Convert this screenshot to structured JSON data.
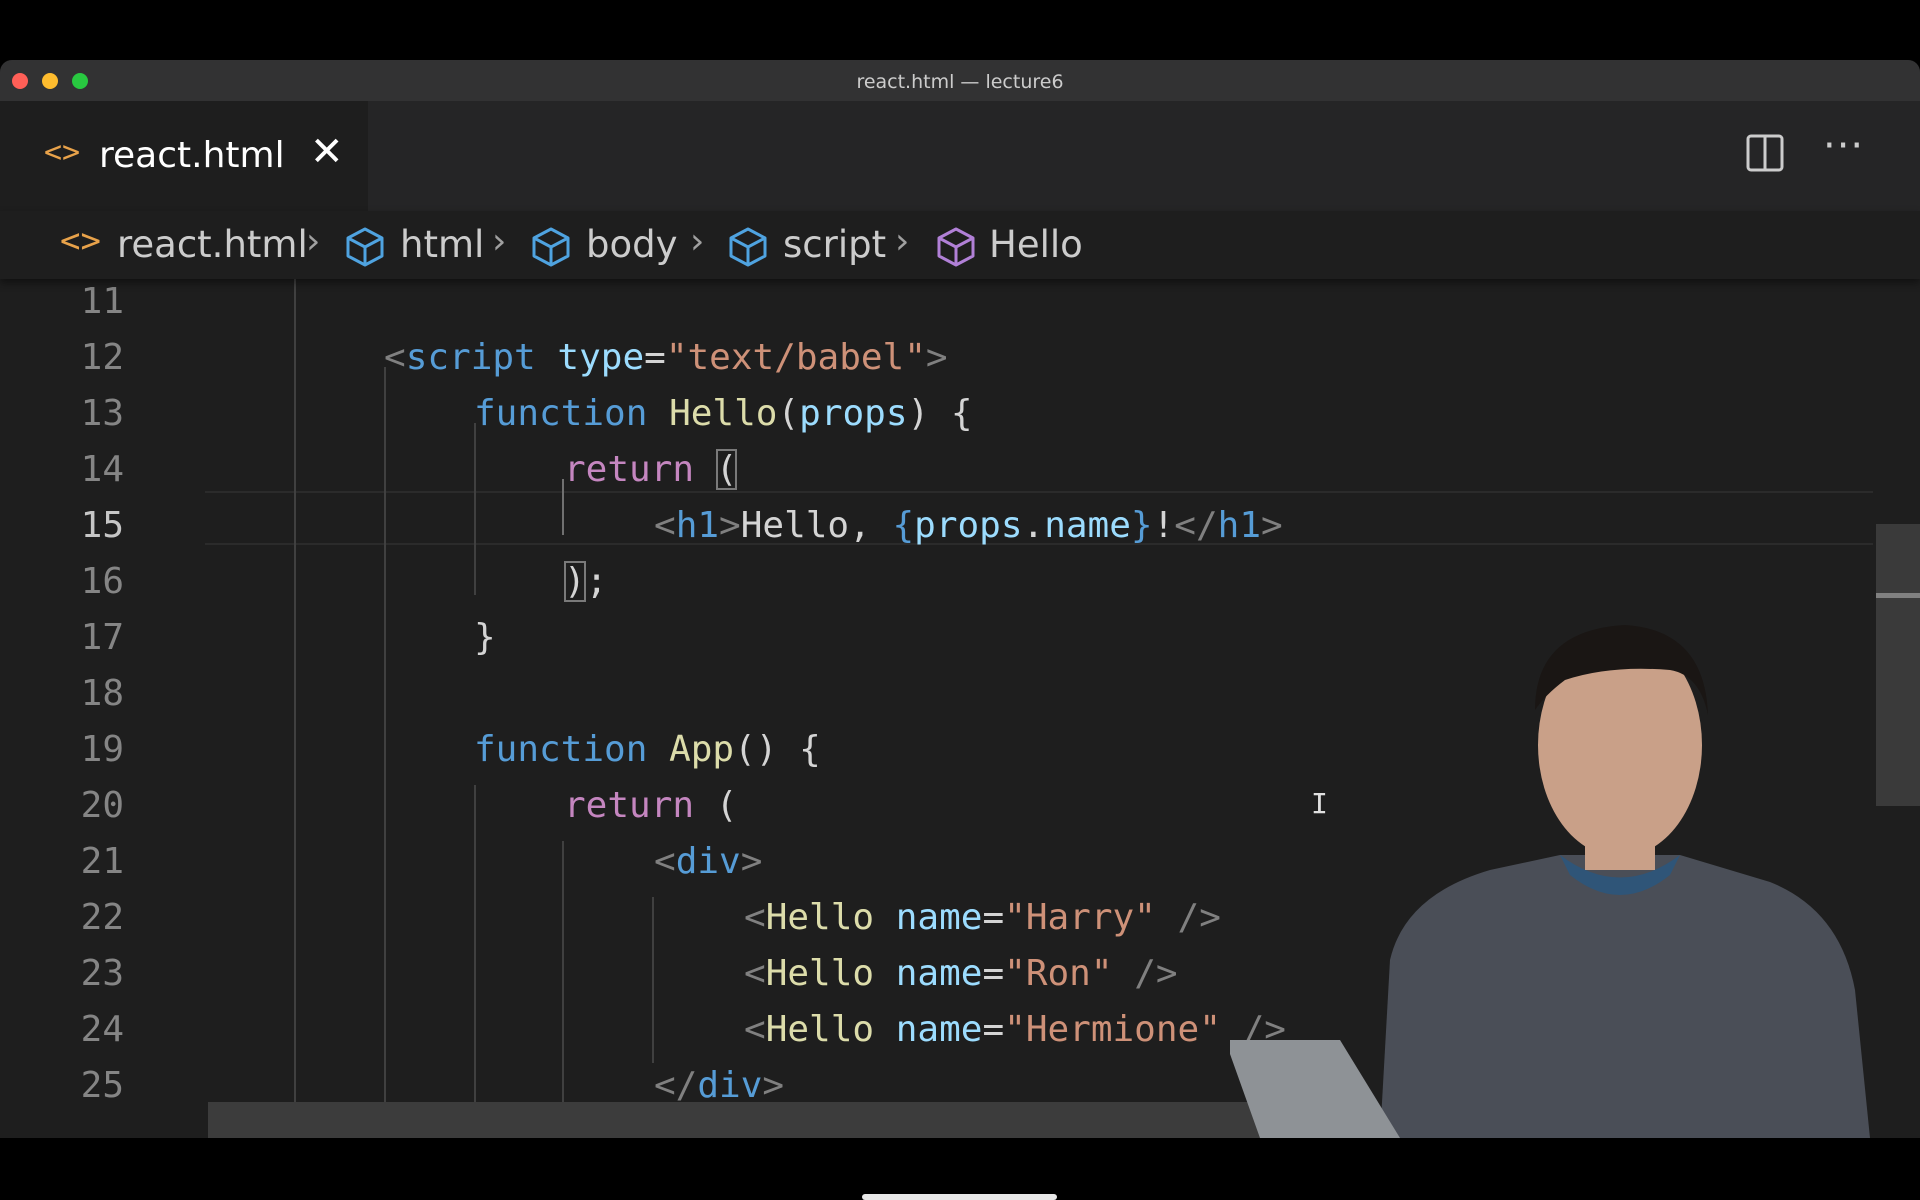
{
  "window": {
    "title": "react.html — lecture6"
  },
  "tab": {
    "icon": "code-brackets-icon",
    "label": "react.html",
    "close_glyph": "✕"
  },
  "toolbar": {
    "split_icon": "split-editor-icon",
    "more_glyph": "···"
  },
  "breadcrumb": {
    "file_icon": "code-brackets-icon",
    "items": [
      {
        "label": "react.html",
        "icon": "code-brackets-icon"
      },
      {
        "label": "html",
        "icon": "cube-icon"
      },
      {
        "label": "body",
        "icon": "cube-icon"
      },
      {
        "label": "script",
        "icon": "cube-icon"
      },
      {
        "label": "Hello",
        "icon": "cube-icon"
      }
    ],
    "separator": "›"
  },
  "editor": {
    "active_line": 15,
    "line_numbers": [
      "11",
      "12",
      "13",
      "14",
      "15",
      "16",
      "17",
      "18",
      "19",
      "20",
      "21",
      "22",
      "23",
      "24",
      "25"
    ],
    "lines": [
      {
        "num": "11",
        "tokens": []
      },
      {
        "num": "12",
        "indent": 1,
        "tokens": [
          {
            "t": "<",
            "c": "tag"
          },
          {
            "t": "script",
            "c": "el"
          },
          {
            "t": " ",
            "c": "txt"
          },
          {
            "t": "type",
            "c": "attr"
          },
          {
            "t": "=",
            "c": "txt"
          },
          {
            "t": "\"text/babel\"",
            "c": "str"
          },
          {
            "t": ">",
            "c": "tag"
          }
        ]
      },
      {
        "num": "13",
        "indent": 2,
        "tokens": [
          {
            "t": "function",
            "c": "kw"
          },
          {
            "t": " ",
            "c": "txt"
          },
          {
            "t": "Hello",
            "c": "fn"
          },
          {
            "t": "(",
            "c": "txt"
          },
          {
            "t": "props",
            "c": "param"
          },
          {
            "t": ") {",
            "c": "txt"
          }
        ]
      },
      {
        "num": "14",
        "indent": 3,
        "tokens": [
          {
            "t": "return",
            "c": "ctrl"
          },
          {
            "t": " ",
            "c": "txt"
          },
          {
            "t": "(",
            "c": "txt",
            "box": true
          }
        ]
      },
      {
        "num": "15",
        "indent": 4,
        "tokens": [
          {
            "t": "<",
            "c": "tag"
          },
          {
            "t": "h1",
            "c": "el"
          },
          {
            "t": ">",
            "c": "tag"
          },
          {
            "t": "Hello, ",
            "c": "txt"
          },
          {
            "t": "{",
            "c": "brace"
          },
          {
            "t": "props",
            "c": "param"
          },
          {
            "t": ".",
            "c": "txt"
          },
          {
            "t": "name",
            "c": "param"
          },
          {
            "t": "}",
            "c": "brace"
          },
          {
            "t": "!",
            "c": "txt"
          },
          {
            "t": "</",
            "c": "tag"
          },
          {
            "t": "h1",
            "c": "el"
          },
          {
            "t": ">",
            "c": "tag"
          }
        ]
      },
      {
        "num": "16",
        "indent": 3,
        "tokens": [
          {
            "t": ")",
            "c": "txt",
            "box": true
          },
          {
            "t": ";",
            "c": "txt"
          }
        ]
      },
      {
        "num": "17",
        "indent": 2,
        "tokens": [
          {
            "t": "}",
            "c": "txt"
          }
        ]
      },
      {
        "num": "18",
        "tokens": []
      },
      {
        "num": "19",
        "indent": 2,
        "tokens": [
          {
            "t": "function",
            "c": "kw"
          },
          {
            "t": " ",
            "c": "txt"
          },
          {
            "t": "App",
            "c": "fn"
          },
          {
            "t": "() {",
            "c": "txt"
          }
        ]
      },
      {
        "num": "20",
        "indent": 3,
        "tokens": [
          {
            "t": "return",
            "c": "ctrl"
          },
          {
            "t": " (",
            "c": "txt"
          }
        ]
      },
      {
        "num": "21",
        "indent": 4,
        "tokens": [
          {
            "t": "<",
            "c": "tag"
          },
          {
            "t": "div",
            "c": "el"
          },
          {
            "t": ">",
            "c": "tag"
          }
        ]
      },
      {
        "num": "22",
        "indent": 5,
        "tokens": [
          {
            "t": "<",
            "c": "tag"
          },
          {
            "t": "Hello",
            "c": "comp"
          },
          {
            "t": " ",
            "c": "txt"
          },
          {
            "t": "name",
            "c": "attr"
          },
          {
            "t": "=",
            "c": "txt"
          },
          {
            "t": "\"Harry\"",
            "c": "str"
          },
          {
            "t": " />",
            "c": "tag"
          }
        ]
      },
      {
        "num": "23",
        "indent": 5,
        "tokens": [
          {
            "t": "<",
            "c": "tag"
          },
          {
            "t": "Hello",
            "c": "comp"
          },
          {
            "t": " ",
            "c": "txt"
          },
          {
            "t": "name",
            "c": "attr"
          },
          {
            "t": "=",
            "c": "txt"
          },
          {
            "t": "\"Ron\"",
            "c": "str"
          },
          {
            "t": " />",
            "c": "tag"
          }
        ]
      },
      {
        "num": "24",
        "indent": 5,
        "tokens": [
          {
            "t": "<",
            "c": "tag"
          },
          {
            "t": "Hello",
            "c": "comp"
          },
          {
            "t": " ",
            "c": "txt"
          },
          {
            "t": "name",
            "c": "attr"
          },
          {
            "t": "=",
            "c": "txt"
          },
          {
            "t": "\"Hermione\"",
            "c": "str"
          },
          {
            "t": " />",
            "c": "tag"
          }
        ]
      },
      {
        "num": "25",
        "indent": 4,
        "tokens": [
          {
            "t": "</",
            "c": "tag"
          },
          {
            "t": "div",
            "c": "el"
          },
          {
            "t": ">",
            "c": "tag"
          }
        ]
      }
    ]
  },
  "colors": {
    "accent_file_icon": "#e8a24a",
    "cube_icon": "#4fa3e0",
    "cube_icon_active": "#b180d7",
    "keyword": "#569cd6",
    "control": "#c586c0",
    "function": "#dcdcaa",
    "string": "#ce9178",
    "attribute": "#9cdcfe"
  },
  "overlay": {
    "presenter_icon": "presenter-video-overlay"
  }
}
